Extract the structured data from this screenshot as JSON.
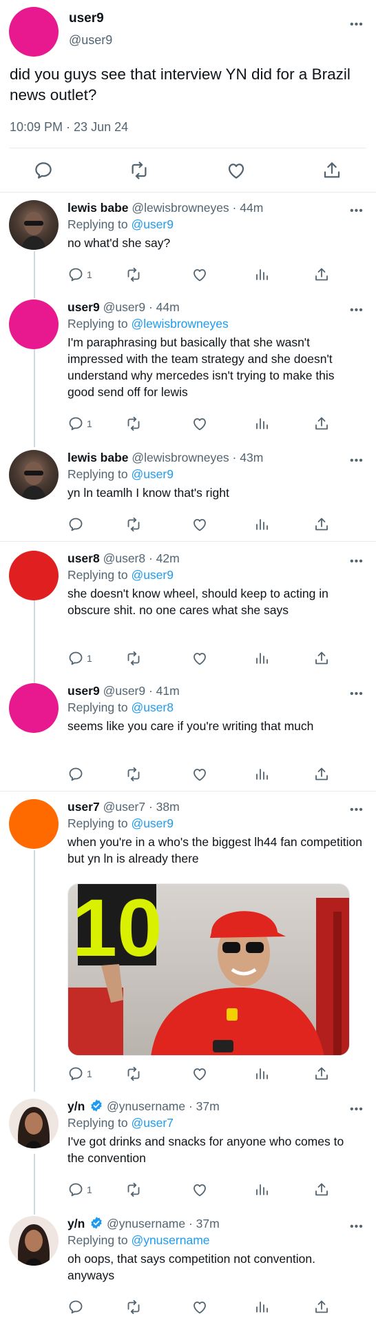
{
  "main": {
    "name": "user9",
    "handle": "@user9",
    "text": "did you guys see that interview YN did for a Brazil news outlet?",
    "time": "10:09 PM · 23 Jun 24",
    "avatar_color": "#e8198f"
  },
  "replies": [
    {
      "name": "lewis babe",
      "handle_meta": "@lewisbrowneyes · 44m",
      "reply_to": "@user9",
      "text": "no what'd she say?",
      "reply_count": "1"
    },
    {
      "name": "user9",
      "handle_meta": "@user9 · 44m",
      "reply_to": "@lewisbrowneyes",
      "text": "I'm paraphrasing but basically that she wasn't impressed with the team strategy and she doesn't understand why mercedes isn't trying to make this good send off for lewis",
      "reply_count": "1",
      "avatar_color": "#e8198f"
    },
    {
      "name": "lewis babe",
      "handle_meta": "@lewisbrowneyes · 43m",
      "reply_to": "@user9",
      "text": "yn ln teamlh I know that's right",
      "reply_count": ""
    },
    {
      "name": "user8",
      "handle_meta": "@user8 · 42m",
      "reply_to": "@user9",
      "text": "she doesn't know wheel, should keep to acting in obscure shit. no one cares what she says",
      "reply_count": "1",
      "avatar_color": "#e02020"
    },
    {
      "name": "user9",
      "handle_meta": "@user9 · 41m",
      "reply_to": "@user8",
      "text": "seems like you care if you're writing that much",
      "reply_count": "",
      "avatar_color": "#e8198f"
    },
    {
      "name": "user7",
      "handle_meta": "@user7 · 38m",
      "reply_to": "@user9",
      "text": "when you're in a who's the biggest lh44 fan competition but yn ln is already there",
      "reply_count": "1",
      "avatar_color": "#ff6a00",
      "media_sign": "10"
    },
    {
      "name": "y/n",
      "handle_meta": "@ynusername · 37m",
      "reply_to": "@user7",
      "text": "I've got drinks and snacks for anyone who comes to the convention",
      "reply_count": "1"
    },
    {
      "name": "y/n",
      "handle_meta": "@ynusername · 37m",
      "reply_to": "@ynusername",
      "text": "oh oops, that says competition not convention. anyways",
      "reply_count": ""
    }
  ],
  "labels": {
    "replying_to": "Replying to",
    "more": "•••"
  },
  "colors": {
    "accent": "#1d9bf0",
    "muted": "#536471",
    "border": "#e6ecf0"
  }
}
